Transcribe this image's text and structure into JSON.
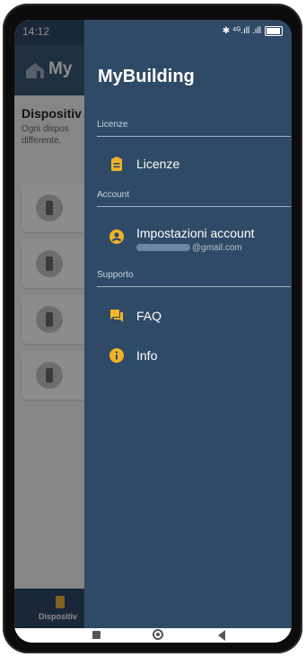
{
  "status_bar": {
    "time": "14:12",
    "icons": "✱ ⁴ᴳ.ıll .ıll",
    "battery": "98"
  },
  "app": {
    "title": "My",
    "section_title": "Dispositiv",
    "section_desc": "Ogni dispos differente.",
    "bottom_nav_label": "Dispositiv"
  },
  "drawer": {
    "header": "MyBuilding",
    "groups": [
      {
        "label": "Licenze",
        "items": [
          {
            "label": "Licenze",
            "icon": "clipboard-icon"
          }
        ]
      },
      {
        "label": "Account",
        "items": [
          {
            "label": "Impostazioni account",
            "icon": "account-circle-icon",
            "email_suffix": "@gmail.com"
          }
        ]
      },
      {
        "label": "Supporto",
        "items": [
          {
            "label": "FAQ",
            "icon": "forum-icon"
          },
          {
            "label": "Info",
            "icon": "info-icon"
          }
        ]
      }
    ]
  },
  "colors": {
    "drawer_bg": "#2f4a66",
    "accent": "#f2b32a"
  }
}
